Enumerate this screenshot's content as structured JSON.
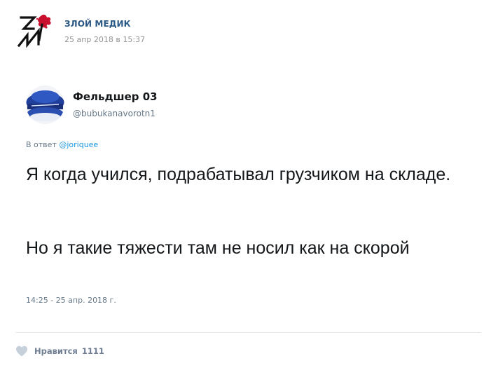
{
  "post": {
    "group_name": "ЗЛОЙ МЕДИК",
    "date": "25 апр 2018 в 15:37",
    "logo_icon": "zm-logo-icon"
  },
  "tweet": {
    "author_name": "Фельдшер 03",
    "author_handle": "@bubukanavorotn1",
    "reply_prefix": "В ответ",
    "reply_to": "@joriquee",
    "text_paragraph_1": "Я когда учился, подрабатывал грузчиком на складе.",
    "text_paragraph_2": "Но я такие тяжести там не носил как на скорой",
    "timestamp": "14:25 - 25 апр. 2018 г."
  },
  "footer": {
    "like_label": "Нравится",
    "like_count": "1111",
    "like_icon": "heart-icon"
  },
  "colors": {
    "link": "#2a5885",
    "twitter_link": "#1b95e0",
    "muted": "#939393",
    "logo_red": "#d0202a"
  }
}
